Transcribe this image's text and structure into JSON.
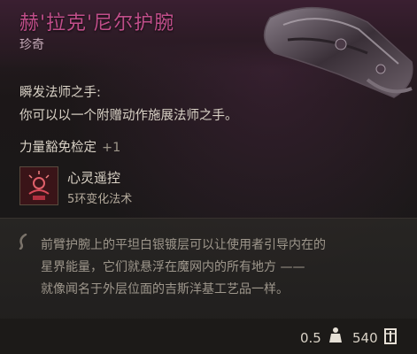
{
  "item": {
    "name": "赫'拉克'尼尔护腕",
    "rarity": "珍奇"
  },
  "property": {
    "name": "瞬发法师之手:",
    "description": "你可以以一个附赠动作施展法师之手。"
  },
  "bonus": {
    "label": "力量豁免检定",
    "value": "+1"
  },
  "spell": {
    "name": "心灵遥控",
    "subtitle": "5环变化法术",
    "icon": "telekinesis-icon"
  },
  "lore": {
    "lines": [
      "前臂护腕上的平坦白银镀层可以让使用者引导内在的",
      "星界能量，它们就悬浮在魔网内的所有地方 ——",
      "就像闻名于外层位面的吉斯洋基工艺品一样。"
    ]
  },
  "footer": {
    "weight": "0.5",
    "price": "540",
    "weight_icon": "weight-icon",
    "price_icon": "gold-coin-icon"
  },
  "colors": {
    "rarity_name": "#c04e8a",
    "background": "#1a1818"
  }
}
